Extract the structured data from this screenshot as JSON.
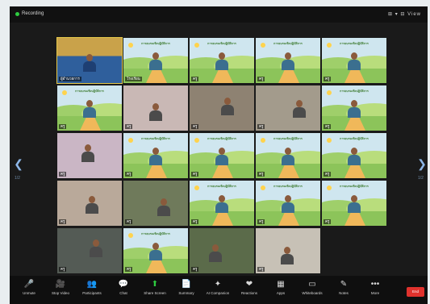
{
  "window": {
    "recording_label": "Recording",
    "top_right_text": "⊞ ▾  ⊟ View"
  },
  "navigation": {
    "left_arrow": "❮",
    "right_arrow": "❯",
    "left_page": "1/2",
    "right_page": "1/2"
  },
  "tiles": [
    {
      "kind": "room",
      "name": "ผู้อำนวยการ",
      "active": true
    },
    {
      "kind": "banner",
      "name": "โรงเรียน",
      "banner": "การอบรมเชิงปฏิบัติการ"
    },
    {
      "kind": "banner",
      "name": "ครู",
      "banner": "การอบรมเชิงปฏิบัติการ"
    },
    {
      "kind": "banner",
      "name": "ครู",
      "banner": "การอบรมเชิงปฏิบัติการ"
    },
    {
      "kind": "banner",
      "name": "ครู",
      "banner": "การอบรมเชิงปฏิบัติการ"
    },
    {
      "kind": "banner",
      "name": "ครู",
      "banner": "การอบรมเชิงปฏิบัติการ"
    },
    {
      "kind": "photo",
      "name": "ครู"
    },
    {
      "kind": "photo",
      "name": "ครู"
    },
    {
      "kind": "photo",
      "name": "ครู"
    },
    {
      "kind": "banner",
      "name": "ครู",
      "banner": "การอบรมเชิงปฏิบัติการ"
    },
    {
      "kind": "photo",
      "name": "ครู"
    },
    {
      "kind": "banner",
      "name": "ครู",
      "banner": "การอบรมเชิงปฏิบัติการ"
    },
    {
      "kind": "banner",
      "name": "ครู",
      "banner": "การอบรมเชิงปฏิบัติการ"
    },
    {
      "kind": "banner",
      "name": "ครู",
      "banner": "การอบรมเชิงปฏิบัติการ"
    },
    {
      "kind": "banner",
      "name": "ครู",
      "banner": "การอบรมเชิงปฏิบัติการ"
    },
    {
      "kind": "photo",
      "name": "ครู"
    },
    {
      "kind": "photo",
      "name": "ครู"
    },
    {
      "kind": "banner",
      "name": "ครู",
      "banner": "การอบรมเชิงปฏิบัติการ"
    },
    {
      "kind": "banner",
      "name": "ครู",
      "banner": "การอบรมเชิงปฏิบัติการ"
    },
    {
      "kind": "banner",
      "name": "ครู",
      "banner": "การอบรมเชิงปฏิบัติการ"
    },
    {
      "kind": "photo",
      "name": "ครู"
    },
    {
      "kind": "banner",
      "name": "ครู",
      "banner": "การอบรมเชิงปฏิบัติการ"
    },
    {
      "kind": "photo",
      "name": "ครู"
    },
    {
      "kind": "photo",
      "name": "ครู"
    }
  ],
  "controls": [
    {
      "label": "Unmute",
      "icon": "🎤",
      "icon_name": "microphone-icon"
    },
    {
      "label": "Stop Video",
      "icon": "🎥",
      "icon_name": "video-camera-icon"
    },
    {
      "label": "Participants",
      "icon": "👥",
      "icon_name": "participants-icon"
    },
    {
      "label": "Chat",
      "icon": "💬",
      "icon_name": "chat-icon"
    },
    {
      "label": "Share Screen",
      "icon": "⬆",
      "icon_name": "share-screen-icon",
      "green": true
    },
    {
      "label": "Summary",
      "icon": "📄",
      "icon_name": "summary-icon"
    },
    {
      "label": "AI Companion",
      "icon": "✦",
      "icon_name": "ai-companion-icon"
    },
    {
      "label": "Reactions",
      "icon": "❤",
      "icon_name": "reactions-icon"
    },
    {
      "label": "Apps",
      "icon": "▦",
      "icon_name": "apps-icon"
    },
    {
      "label": "Whiteboards",
      "icon": "▭",
      "icon_name": "whiteboard-icon"
    },
    {
      "label": "Notes",
      "icon": "✎",
      "icon_name": "notes-icon"
    },
    {
      "label": "More",
      "icon": "•••",
      "icon_name": "more-icon"
    }
  ],
  "end_button": "End"
}
